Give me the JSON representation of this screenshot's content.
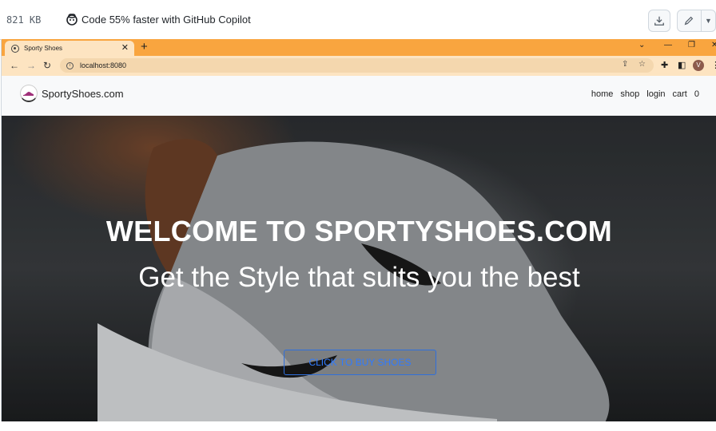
{
  "github_bar": {
    "file_size": "821 KB",
    "copilot_promo": "Code 55% faster with GitHub Copilot"
  },
  "browser": {
    "tab_title": "Sporty Shoes",
    "url": "localhost:8080",
    "profile_initial": "V",
    "accent_color": "#f9a53f"
  },
  "site": {
    "brand": "SportyShoes.com",
    "nav": {
      "home": "home",
      "shop": "shop",
      "login": "login",
      "cart": "cart",
      "cart_count": "0"
    },
    "hero": {
      "title": "WELCOME TO SPORTYSHOES.COM",
      "subtitle": "Get the Style that suits you the best",
      "cta": "CLICK TO BUY SHOES"
    }
  }
}
